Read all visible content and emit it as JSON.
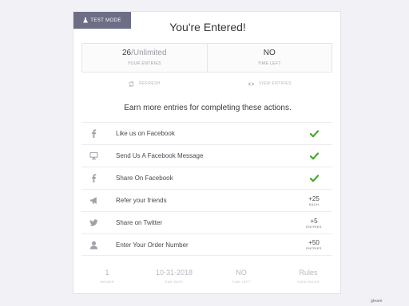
{
  "badge": {
    "label": "TEST MODE"
  },
  "header": {
    "title": "You're Entered!"
  },
  "stats": {
    "entries_value": "26",
    "entries_suffix": "/Unlimited",
    "entries_label": "YOUR ENTRIES",
    "time_value": "NO",
    "time_label": "TIME LEFT"
  },
  "actions": {
    "refresh": "REFRESH",
    "view_entries": "VIEW ENTRIES"
  },
  "earn_text": "Earn more entries for completing these actions.",
  "entries": [
    {
      "icon": "facebook-icon",
      "label": "Like us on Facebook",
      "status": "completed"
    },
    {
      "icon": "monitor-icon",
      "label": "Send Us A Facebook Message",
      "status": "completed"
    },
    {
      "icon": "facebook-icon",
      "label": "Share On Facebook",
      "status": "completed"
    },
    {
      "icon": "megaphone-icon",
      "label": "Refer your friends",
      "points": "+25",
      "unit": "EACH"
    },
    {
      "icon": "twitter-icon",
      "label": "Share on Twitter",
      "points": "+5",
      "unit": "ENTRIES"
    },
    {
      "icon": "user-icon",
      "label": "Enter Your Order Number",
      "points": "+50",
      "unit": "ENTRIES"
    }
  ],
  "footer": [
    {
      "value": "1",
      "label": "WINNER"
    },
    {
      "value": "10-31-2018",
      "label": "END DATE"
    },
    {
      "value": "NO",
      "label": "TIME LEFT"
    },
    {
      "value": "Rules",
      "label": "VIEW RULES"
    }
  ],
  "watermark": "gleam",
  "colors": {
    "check": "#47a82e",
    "badge": "#6d6e86"
  }
}
